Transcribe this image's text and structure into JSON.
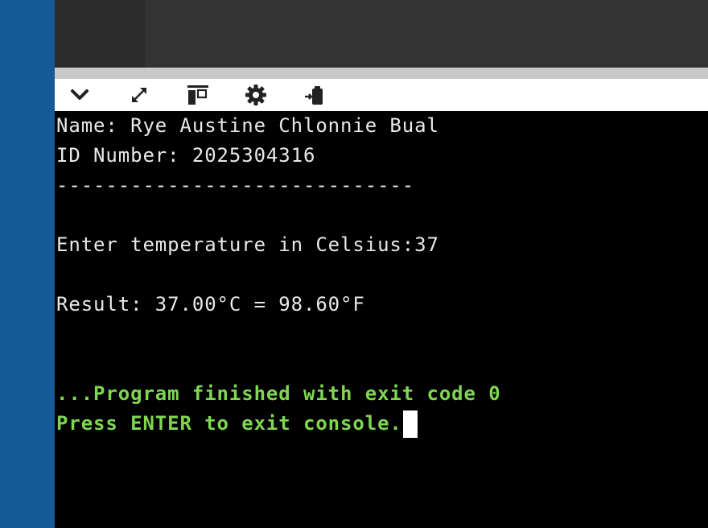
{
  "toolbar": {
    "icons": [
      "chevron-down-icon",
      "expand-icon",
      "layout-icon",
      "gear-icon",
      "clipboard-icon"
    ]
  },
  "console": {
    "lines": [
      "Name: Rye Austine Chlonnie Bual",
      "ID Number: 2025304316",
      "-----------------------------",
      "",
      "Enter temperature in Celsius:37",
      "",
      "Result: 37.00°C = 98.60°F",
      "",
      "",
      "...Program finished with exit code 0",
      "Press ENTER to exit console."
    ],
    "text_color": "#e8e8e8",
    "status_color": "#7fd651"
  },
  "colors": {
    "left_strip": "#135a96",
    "top_bar": "#333333",
    "toolbar_bg": "#ffffff",
    "console_bg": "#000000"
  }
}
